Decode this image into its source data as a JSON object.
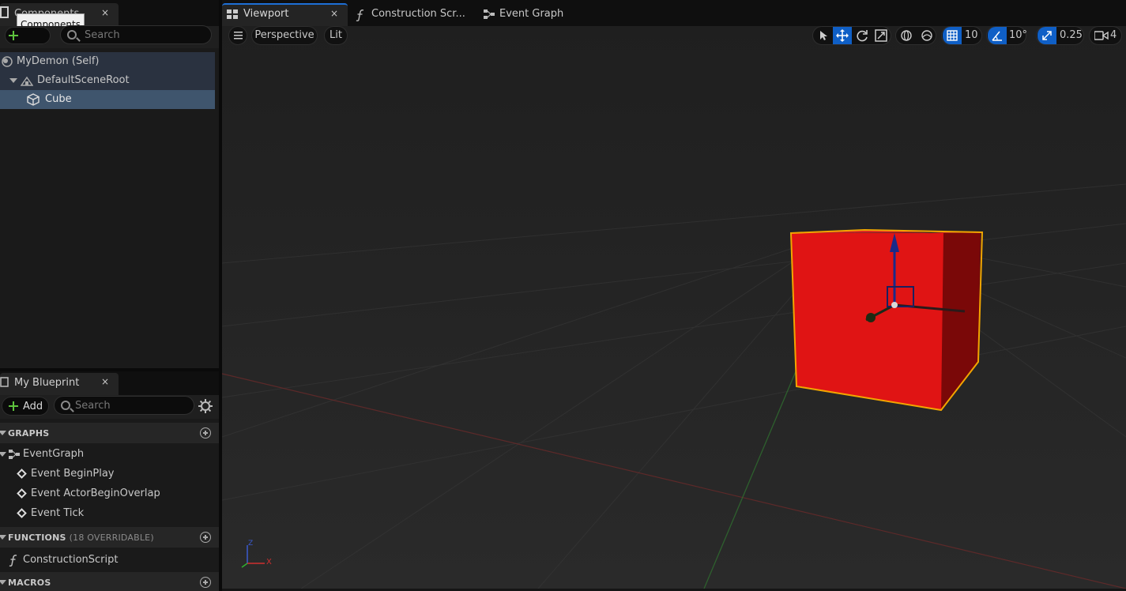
{
  "components_panel": {
    "tab_title": "Components",
    "tooltip": "Components",
    "close": "×",
    "add_label": "Add",
    "search_placeholder": "Search",
    "tree": [
      {
        "label": "MyDemon (Self)"
      },
      {
        "label": "DefaultSceneRoot"
      },
      {
        "label": "Cube"
      }
    ]
  },
  "my_blueprint": {
    "tab_title": "My Blueprint",
    "close": "×",
    "add_label": "Add",
    "search_placeholder": "Search",
    "sections": {
      "graphs": {
        "label": "GRAPHS"
      },
      "functions": {
        "label": "FUNCTIONS",
        "sub": "(18 OVERRIDABLE)"
      },
      "macros": {
        "label": "MACROS"
      }
    },
    "event_graph": "EventGraph",
    "events": [
      "Event BeginPlay",
      "Event ActorBeginOverlap",
      "Event Tick"
    ],
    "construction_script": "ConstructionScript"
  },
  "editor_tabs": [
    {
      "label": "Viewport",
      "close": "×"
    },
    {
      "label": "Construction Scr..."
    },
    {
      "label": "Event Graph"
    }
  ],
  "viewport_toolbar": {
    "view_mode": "Perspective",
    "lighting": "Lit",
    "grid_snap": "10",
    "rotation_snap": "10°",
    "scale_snap": "0.25",
    "camera_speed": "4"
  },
  "axis_gizmo": {
    "x": "X",
    "z": "Z"
  },
  "colors": {
    "cube": "#e01414",
    "selection_outline": "#f2a500",
    "accent_blue": "#0f5fc6",
    "panel_bg": "#1a1a1a",
    "viewport_bg": "#242424"
  }
}
